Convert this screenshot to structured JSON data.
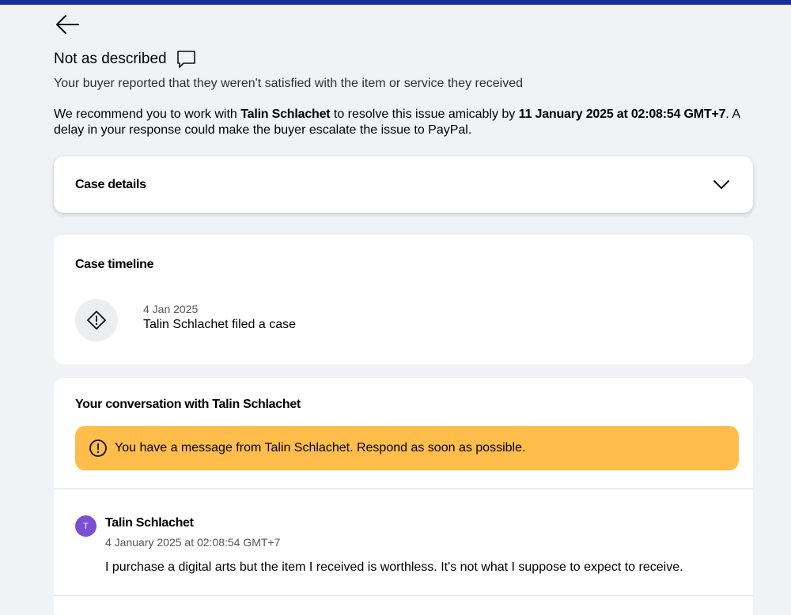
{
  "header": {
    "title": "Not as described",
    "subtitle": "Your buyer reported that they weren't satisfied with the item or service they received"
  },
  "recommendation": {
    "part1": "We recommend you to work with ",
    "buyer_name": "Talin Schlachet",
    "part2": " to resolve this issue amicably by ",
    "deadline": "11 January 2025 at 02:08:54 GMT+7",
    "part3": ". A delay in your response could make the buyer escalate the issue to PayPal."
  },
  "case_details": {
    "title": "Case details"
  },
  "timeline": {
    "title": "Case timeline",
    "events": [
      {
        "date": "4 Jan 2025",
        "text": "Talin Schlachet filed a case"
      }
    ]
  },
  "conversation": {
    "title": "Your conversation with Talin Schlachet",
    "alert": "You have a message from Talin Schlachet. Respond as soon as possible.",
    "messages": [
      {
        "avatar_initial": "T",
        "author": "Talin Schlachet",
        "timestamp": "4 January 2025 at 02:08:54 GMT+7",
        "body": "I purchase a digital arts but the item I received is worthless. It's not what I suppose to expect to receive."
      }
    ]
  },
  "colors": {
    "top_bar": "#1b2c98",
    "alert_bg": "#ffbd4b",
    "avatar_bg": "#7b4fd1",
    "page_bg": "#f1f2f4"
  },
  "icons": {
    "back": "arrow-left-icon",
    "chat": "chat-bubble-icon",
    "chevron": "chevron-down-icon",
    "timeline": "warning-diamond-icon",
    "alert": "info-circle-icon"
  }
}
